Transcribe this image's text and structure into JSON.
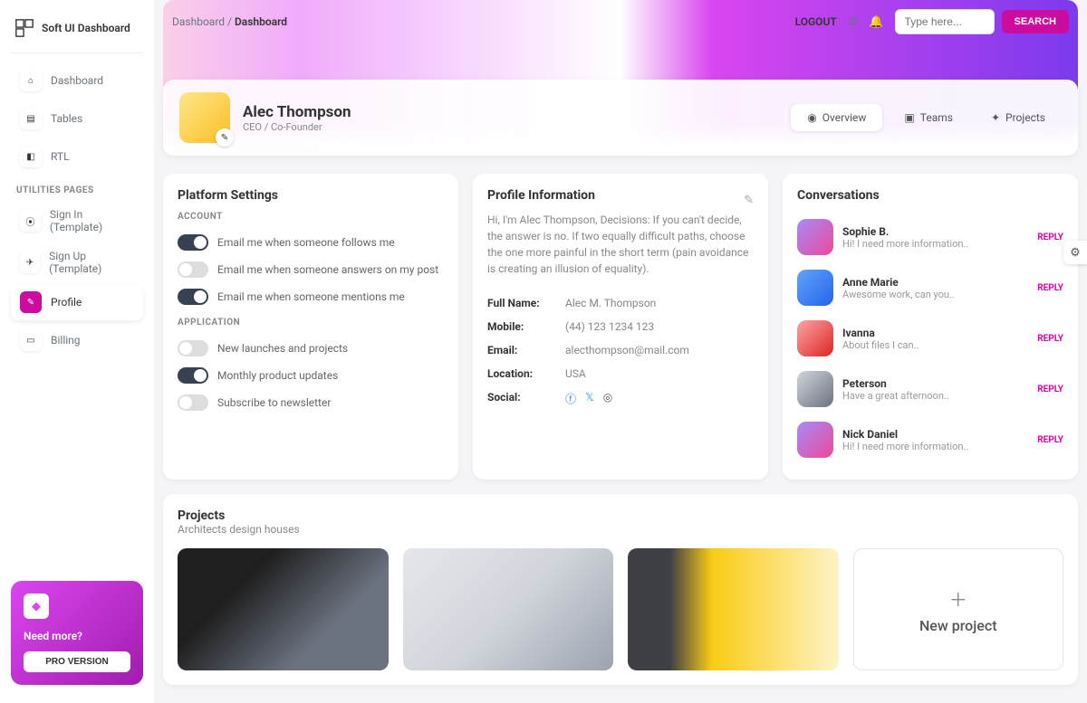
{
  "brand": "Soft UI Dashboard",
  "breadcrumb": {
    "root": "Dashboard",
    "current": "Dashboard"
  },
  "topbar": {
    "logout": "LOGOUT",
    "search_placeholder": "Type here...",
    "search_btn": "SEARCH"
  },
  "nav": {
    "items": [
      {
        "label": "Dashboard",
        "icon": "⌂"
      },
      {
        "label": "Tables",
        "icon": "▤"
      },
      {
        "label": "RTL",
        "icon": "◧"
      }
    ],
    "utilities_title": "UTILITIES PAGES",
    "utilities": [
      {
        "label": "Sign In (Template)",
        "icon": "⦿"
      },
      {
        "label": "Sign Up (Template)",
        "icon": "✈"
      },
      {
        "label": "Profile",
        "icon": "✎",
        "active": true
      },
      {
        "label": "Billing",
        "icon": "▭"
      }
    ]
  },
  "promo": {
    "title": "Need more?",
    "button": "PRO VERSION"
  },
  "profile": {
    "name": "Alec Thompson",
    "role": "CEO / Co-Founder"
  },
  "tabs": [
    {
      "label": "Overview",
      "icon": "◉",
      "active": true
    },
    {
      "label": "Teams",
      "icon": "▣"
    },
    {
      "label": "Projects",
      "icon": "✦"
    }
  ],
  "platform": {
    "title": "Platform Settings",
    "account_head": "ACCOUNT",
    "application_head": "APPLICATION",
    "account": [
      {
        "label": "Email me when someone follows me",
        "on": true
      },
      {
        "label": "Email me when someone answers on my post",
        "on": false
      },
      {
        "label": "Email me when someone mentions me",
        "on": true
      }
    ],
    "application": [
      {
        "label": "New launches and projects",
        "on": false
      },
      {
        "label": "Monthly product updates",
        "on": true
      },
      {
        "label": "Subscribe to newsletter",
        "on": false
      }
    ]
  },
  "info": {
    "title": "Profile Information",
    "bio": "Hi, I'm Alec Thompson, Decisions: If you can't decide, the answer is no. If two equally difficult paths, choose the one more painful in the short term (pain avoidance is creating an illusion of equality).",
    "fields": {
      "fullname_label": "Full Name:",
      "fullname": "Alec M. Thompson",
      "mobile_label": "Mobile:",
      "mobile": "(44) 123 1234 123",
      "email_label": "Email:",
      "email": "alecthompson@mail.com",
      "location_label": "Location:",
      "location": "USA",
      "social_label": "Social:"
    }
  },
  "conversations": {
    "title": "Conversations",
    "reply": "REPLY",
    "items": [
      {
        "name": "Sophie B.",
        "msg": "Hi! I need more information.."
      },
      {
        "name": "Anne Marie",
        "msg": "Awesome work, can you.."
      },
      {
        "name": "Ivanna",
        "msg": "About files I can.."
      },
      {
        "name": "Peterson",
        "msg": "Have a great afternoon.."
      },
      {
        "name": "Nick Daniel",
        "msg": "Hi! I need more information.."
      }
    ]
  },
  "projects": {
    "title": "Projects",
    "subtitle": "Architects design houses",
    "new_label": "New project"
  }
}
